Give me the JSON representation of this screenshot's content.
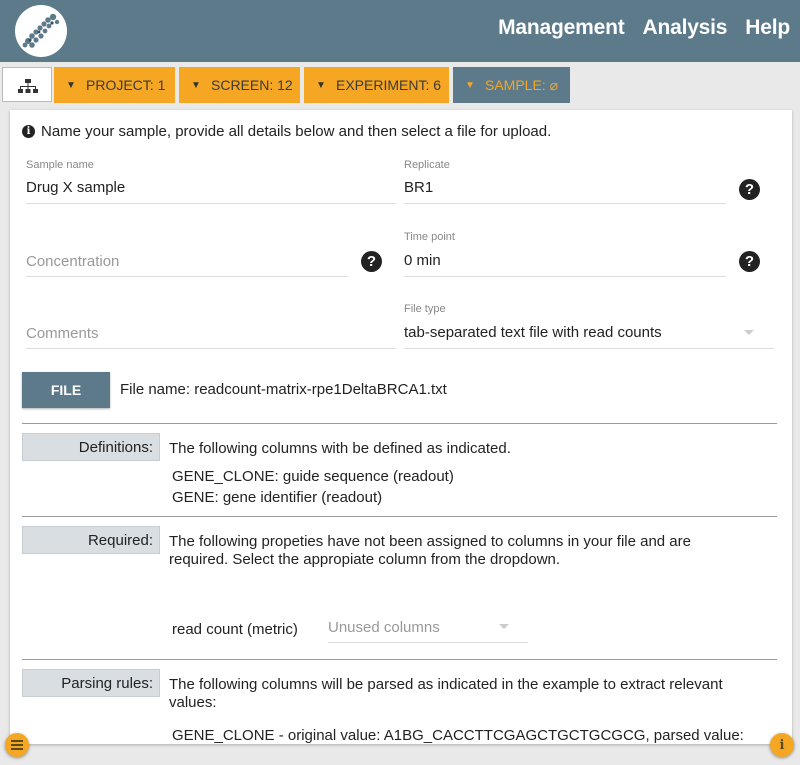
{
  "header": {
    "nav": [
      "Management",
      "Analysis",
      "Help"
    ]
  },
  "breadcrumb": {
    "project": "PROJECT: 1",
    "screen": "SCREEN: 12",
    "experiment": "EXPERIMENT: 6",
    "sample": "SAMPLE: ⌀"
  },
  "intro": "Name your sample, provide all details below and then select a file for upload.",
  "form": {
    "sample_name": {
      "label": "Sample name",
      "value": "Drug X sample"
    },
    "replicate": {
      "label": "Replicate",
      "value": "BR1"
    },
    "concentration": {
      "placeholder": "Concentration"
    },
    "time_point": {
      "label": "Time point",
      "value": "0 min"
    },
    "comments": {
      "placeholder": "Comments"
    },
    "file_type": {
      "label": "File type",
      "value": "tab-separated text file with read counts"
    }
  },
  "file": {
    "button": "FILE",
    "name_text": "File name: readcount-matrix-rpe1DeltaBRCA1.txt"
  },
  "definitions": {
    "tag": "Definitions:",
    "text": "The following columns with be defined as indicated.",
    "items": [
      "GENE_CLONE: guide sequence (readout)",
      "GENE: gene identifier (readout)"
    ]
  },
  "required": {
    "tag": "Required:",
    "text_line1": "The following propeties have not been assigned to columns in your file and are",
    "text_line2": "required. Select the appropiate column from the dropdown.",
    "metric_label": "read count (metric)",
    "select_placeholder": "Unused columns"
  },
  "parsing": {
    "tag": "Parsing rules:",
    "text_line1": "The following columns will be parsed as indicated in the example to extract relevant",
    "text_line2": "values:",
    "example": "GENE_CLONE - original value: A1BG_CACCTTCGAGCTGCTGCGCG, parsed value:"
  },
  "icons": {
    "help_glyph": "?",
    "info_glyph": "i",
    "chevron": "⌄"
  },
  "colors": {
    "header": "#5d7a8b",
    "accent": "#f5a623"
  }
}
